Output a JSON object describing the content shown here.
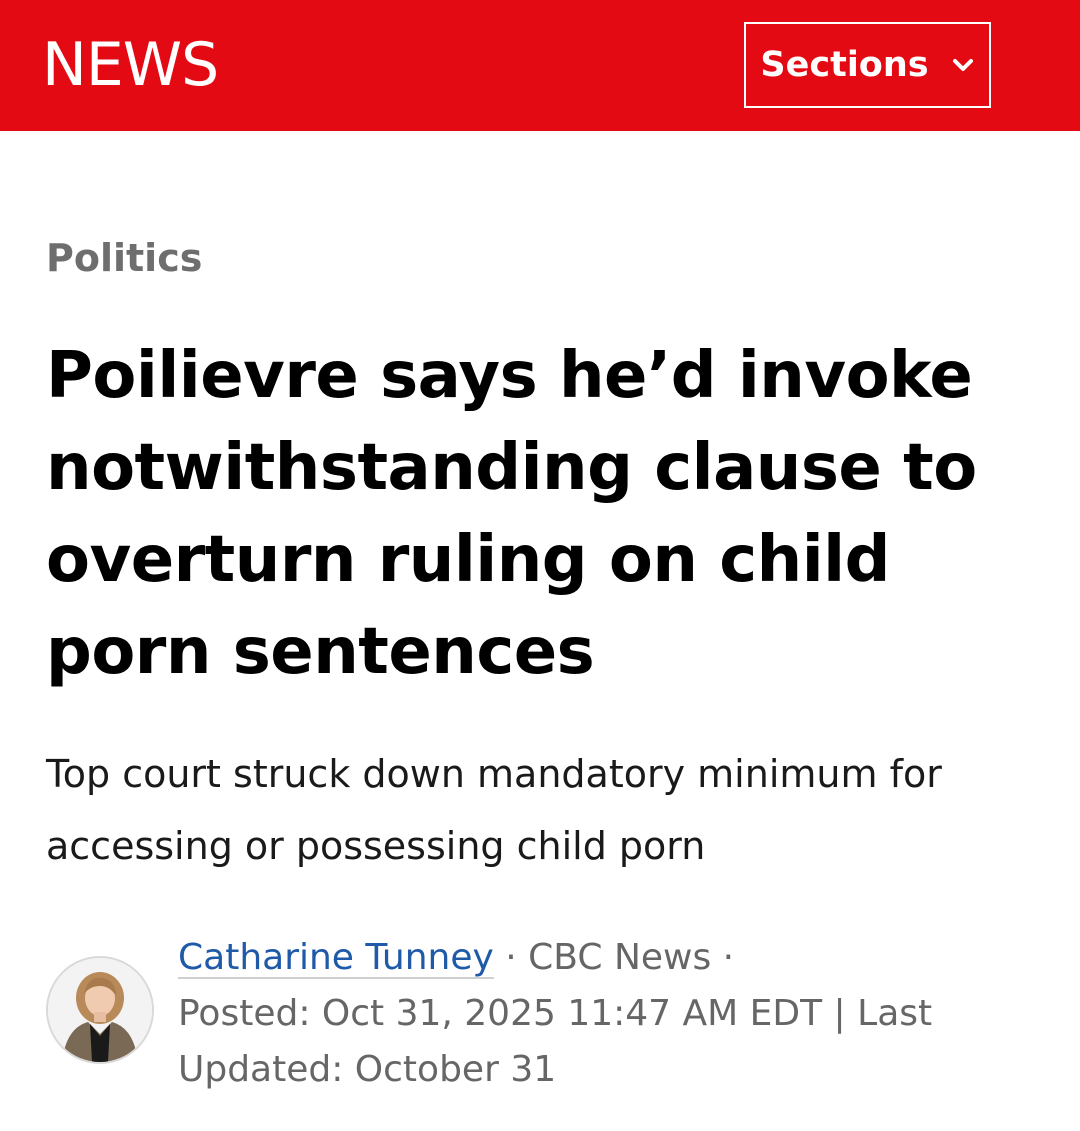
{
  "header": {
    "logo_text": "NEWS",
    "sections_label": "Sections",
    "bar_color": "#e30a13"
  },
  "article": {
    "category": "Politics",
    "headline": "Poilievre says he’d invoke notwithstanding clause to overturn ruling on child porn sentences",
    "deck": "Top court struck down mandatory minimum for accessing or possessing child porn",
    "byline": {
      "author": "Catharine Tunney",
      "separator_1": " · ",
      "outlet": "CBC News",
      "separator_2": " · ",
      "posted": "Posted: Oct 31, 2025 11:47 AM EDT | Last Updated: October 31",
      "author_color": "#1f5aa8"
    }
  },
  "icons": {
    "sections_chevron": "chevron-down-icon",
    "avatar": "author-avatar"
  }
}
